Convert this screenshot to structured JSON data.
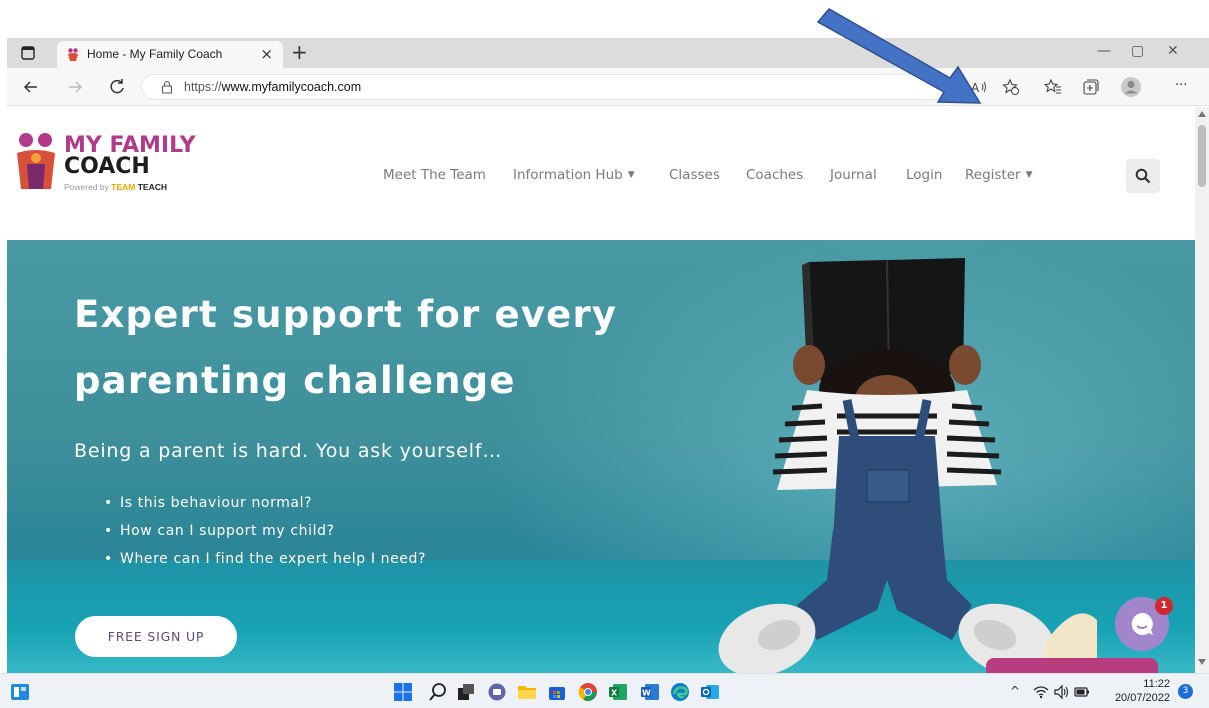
{
  "browser": {
    "tab_title": "Home - My Family Coach",
    "tab_close": "×",
    "new_tab": "+",
    "url_prefix": "https://",
    "url_host": "www.myfamilycoach.com",
    "window_controls": {
      "minimize": "—",
      "maximize": "▢",
      "close": "✕"
    },
    "more_menu": "···"
  },
  "site": {
    "logo": {
      "line1": "MY FAMILY",
      "line2": "COACH",
      "powered_prefix": "Powered by ",
      "powered_brand1": "TEAM",
      "powered_brand2": "TEACH"
    },
    "nav": [
      {
        "label": "Meet The Team"
      },
      {
        "label": "Information Hub",
        "has_dropdown": true
      },
      {
        "label": "Classes"
      },
      {
        "label": "Coaches"
      },
      {
        "label": "Journal"
      },
      {
        "label": "Login"
      },
      {
        "label": "Register",
        "has_dropdown": true
      }
    ],
    "caret": "▼"
  },
  "hero": {
    "title_line1": "Expert support for every",
    "title_line2": "parenting challenge",
    "subtitle": "Being a parent is hard. You ask yourself…",
    "questions": [
      "Is this behaviour normal?",
      "How can I support my child?",
      "Where can I find the expert help I need?"
    ],
    "cta_label": "FREE SIGN UP"
  },
  "chat": {
    "badge_count": "1"
  },
  "taskbar": {
    "time": "11:22",
    "date": "20/07/2022",
    "tray_chevron": "^",
    "notification_count": "3"
  },
  "colors": {
    "brand_magenta": "#b23a8a",
    "hero_teal": "#3f8f9b",
    "chat_purple": "#a286cc",
    "annotation_arrow": "#4472c4"
  }
}
